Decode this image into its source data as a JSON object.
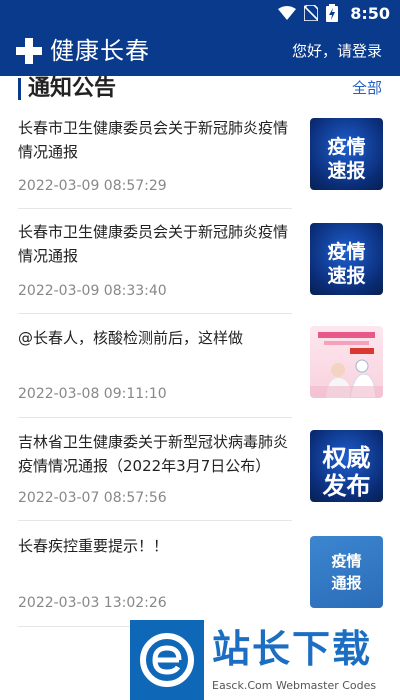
{
  "status_bar": {
    "time": "8:50"
  },
  "app_bar": {
    "title": "健康长春",
    "login": "您好，请登录"
  },
  "section": {
    "title": "通知公告",
    "more": "全部"
  },
  "news": [
    {
      "title": "长春市卫生健康委员会关于新冠肺炎疫情情况通报",
      "date": "2022-03-09 08:57:29",
      "thumb_text": [
        "疫情",
        "速报"
      ]
    },
    {
      "title": "长春市卫生健康委员会关于新冠肺炎疫情情况通报",
      "date": "2022-03-09 08:33:40",
      "thumb_text": [
        "疫情",
        "速报"
      ]
    },
    {
      "title": "@长春人，核酸检测前后，这样做",
      "date": "2022-03-08 09:11:10",
      "thumb_text": []
    },
    {
      "title": "吉林省卫生健康委关于新型冠状病毒肺炎疫情情况通报（2022年3月7日公布）",
      "date": "2022-03-07 08:57:56",
      "thumb_text": [
        "权威",
        "发布"
      ]
    },
    {
      "title": "长春疾控重要提示！！",
      "date": "2022-03-03 13:02:26",
      "thumb_text": [
        "疫情",
        "通报"
      ]
    }
  ],
  "watermark": {
    "text": "站长下载",
    "subtext": "Easck.Com Webmaster Codes"
  },
  "colors": {
    "brand": "#0a3a8c",
    "link": "#2860c0",
    "date": "#888888"
  }
}
